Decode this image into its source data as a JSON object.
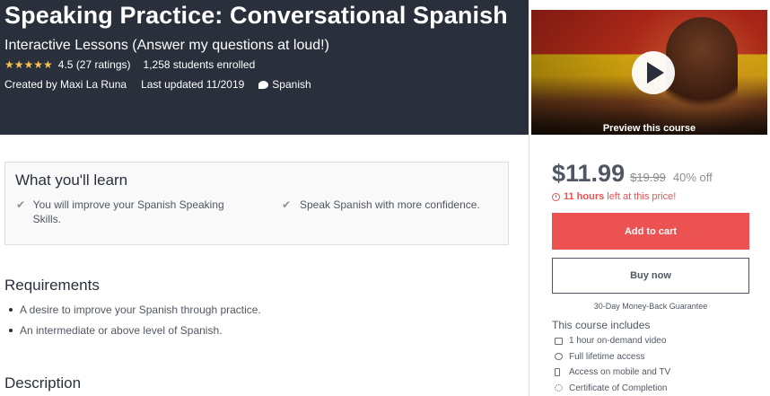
{
  "course": {
    "title": "Speaking Practice: Conversational Spanish",
    "subtitle": "Interactive Lessons (Answer my questions at loud!)",
    "stars": "★★★★★",
    "rating_text": "4.5 (27 ratings)",
    "students": "1,258 students enrolled",
    "created_by": "Created by Maxi La Runa",
    "last_updated": "Last updated 11/2019",
    "language": "Spanish"
  },
  "preview": {
    "label": "Preview this course"
  },
  "learn": {
    "title": "What you'll learn",
    "items": [
      "You will improve your Spanish Speaking Skills.",
      "Speak Spanish with more confidence."
    ]
  },
  "requirements": {
    "title": "Requirements",
    "items": [
      "A desire to improve your Spanish through practice.",
      "An intermediate or above level of Spanish."
    ]
  },
  "description": {
    "title": "Description"
  },
  "purchase": {
    "price": "$11.99",
    "original_price": "$19.99",
    "discount": "40% off",
    "timer_bold": "11 hours",
    "timer_rest": "left at this price!",
    "add_to_cart": "Add to cart",
    "buy_now": "Buy now",
    "guarantee": "30-Day Money-Back Guarantee",
    "includes_title": "This course includes",
    "includes": [
      "1 hour on-demand video",
      "Full lifetime access",
      "Access on mobile and TV",
      "Certificate of Completion"
    ]
  },
  "colors": {
    "hero_bg": "#29303b",
    "accent_red": "#ec5252",
    "star": "#f4c150"
  }
}
